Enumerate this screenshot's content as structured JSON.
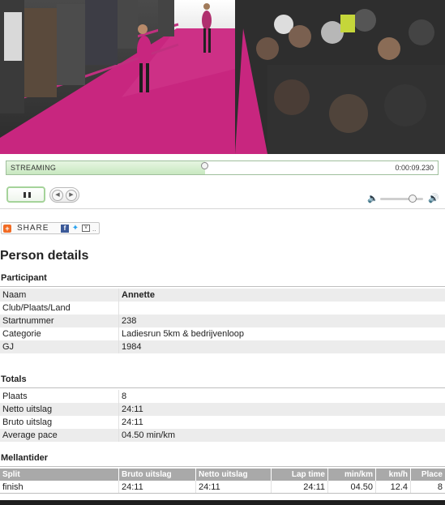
{
  "player": {
    "status_label": "STREAMING",
    "time": "0:00:09.230",
    "progress_fraction": 0.46,
    "volume_fraction": 0.75,
    "icons": {
      "pause": "pause-icon",
      "skip_back": "skip-back-icon",
      "skip_forward": "skip-forward-icon",
      "volume_low": "volume-low-icon",
      "volume_high": "volume-high-icon"
    }
  },
  "share": {
    "label": "SHARE",
    "more": "..",
    "icons": [
      "share-plus-icon",
      "facebook-icon",
      "twitter-icon",
      "email-icon"
    ]
  },
  "page_title": "Person details",
  "participant": {
    "heading": "Participant",
    "rows": [
      {
        "label": "Naam",
        "value": "Annette"
      },
      {
        "label": "Club/Plaats/Land",
        "value": ""
      },
      {
        "label": "Startnummer",
        "value": "238"
      },
      {
        "label": "Categorie",
        "value": "Ladiesrun 5km & bedrijvenloop"
      },
      {
        "label": "GJ",
        "value": "1984"
      }
    ]
  },
  "totals": {
    "heading": "Totals",
    "rows": [
      {
        "label": "Plaats",
        "value": "8"
      },
      {
        "label": "Netto uitslag",
        "value": "24:11"
      },
      {
        "label": "Bruto uitslag",
        "value": "24:11"
      },
      {
        "label": "Average pace",
        "value": "04.50 min/km"
      }
    ]
  },
  "splits": {
    "heading": "Mellantider",
    "columns": [
      "Split",
      "Bruto uitslag",
      "Netto uitslag",
      "Lap time",
      "min/km",
      "km/h",
      "Place"
    ],
    "rows": [
      [
        "finish",
        "24:11",
        "24:11",
        "24:11",
        "04.50",
        "12.4",
        "8"
      ]
    ]
  },
  "colors": {
    "carpet": "#c8267f",
    "progress_fill": "#c8e8c0",
    "play_border": "#a5d39a",
    "table_header": "#a9a9a9"
  }
}
